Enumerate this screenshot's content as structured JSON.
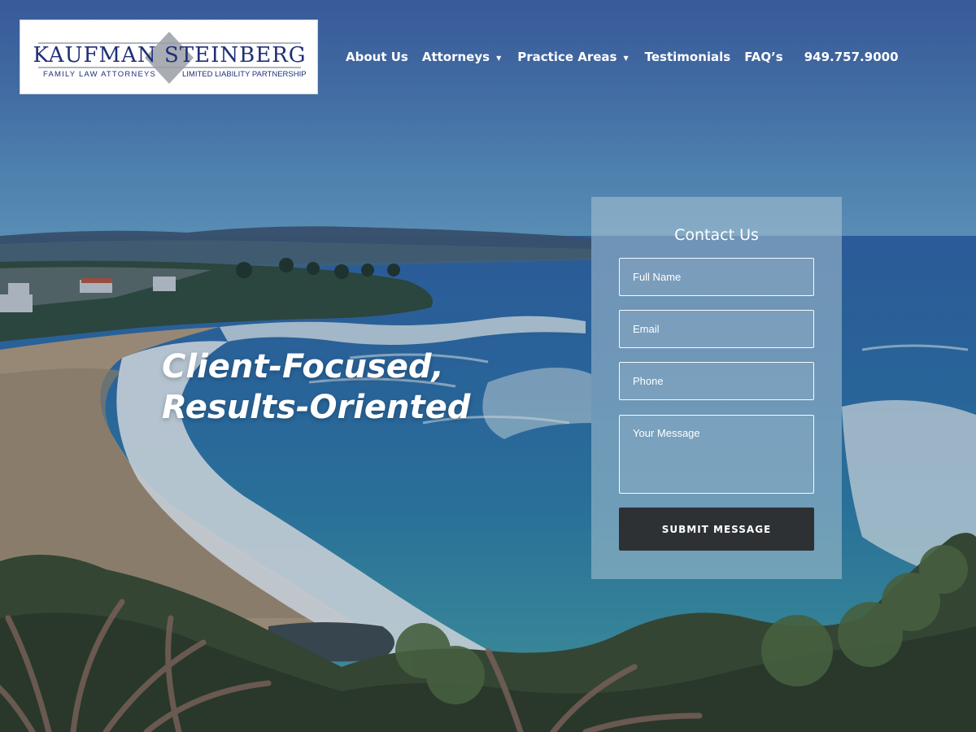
{
  "logo": {
    "main": "KAUFMAN STEINBERG",
    "left_tagline": "FAMILY LAW ATTORNEYS",
    "right_tagline": "LIMITED LIABILITY PARTNERSHIP"
  },
  "nav": {
    "items": [
      {
        "label": "About Us",
        "has_dropdown": false
      },
      {
        "label": "Attorneys",
        "has_dropdown": true
      },
      {
        "label": "Practice Areas",
        "has_dropdown": true
      },
      {
        "label": "Testimonials",
        "has_dropdown": false
      },
      {
        "label": "FAQ’s",
        "has_dropdown": false
      }
    ],
    "phone": "949.757.9000",
    "caret_glyph": "▼"
  },
  "hero": {
    "line1": "Client-Focused,",
    "line2": "Results-Oriented"
  },
  "contact": {
    "title": "Contact Us",
    "full_name_placeholder": "Full Name",
    "email_placeholder": "Email",
    "phone_placeholder": "Phone",
    "message_placeholder": "Your Message",
    "submit_label": "SUBMIT MESSAGE"
  },
  "colors": {
    "brand_navy": "#1f2f78",
    "submit_bg": "#2e3134"
  }
}
